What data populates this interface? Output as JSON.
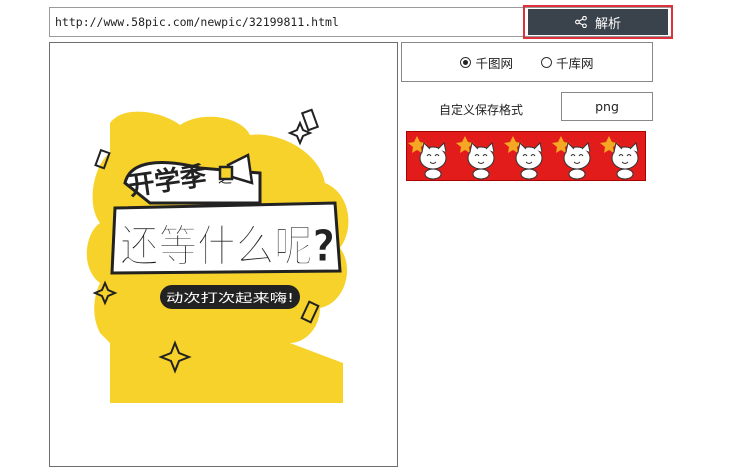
{
  "url_bar": {
    "value": "http://www.58pic.com/newpic/32199811.html",
    "button_label": "解析",
    "button_icon": "share-icon"
  },
  "preview": {
    "line1": "开学季",
    "line1_suffix": "之",
    "line2": "还等什么呢?",
    "line3": "动次打次起来嗨!"
  },
  "sources": [
    {
      "label": "千图网",
      "selected": true
    },
    {
      "label": "千库网",
      "selected": false
    }
  ],
  "format": {
    "label": "自定义保存格式",
    "value": "png"
  },
  "colors": {
    "button_bg": "#3a424c",
    "highlight": "#e0303a",
    "poster_yellow": "#f7d22a",
    "strip_red": "#e21b1b"
  }
}
